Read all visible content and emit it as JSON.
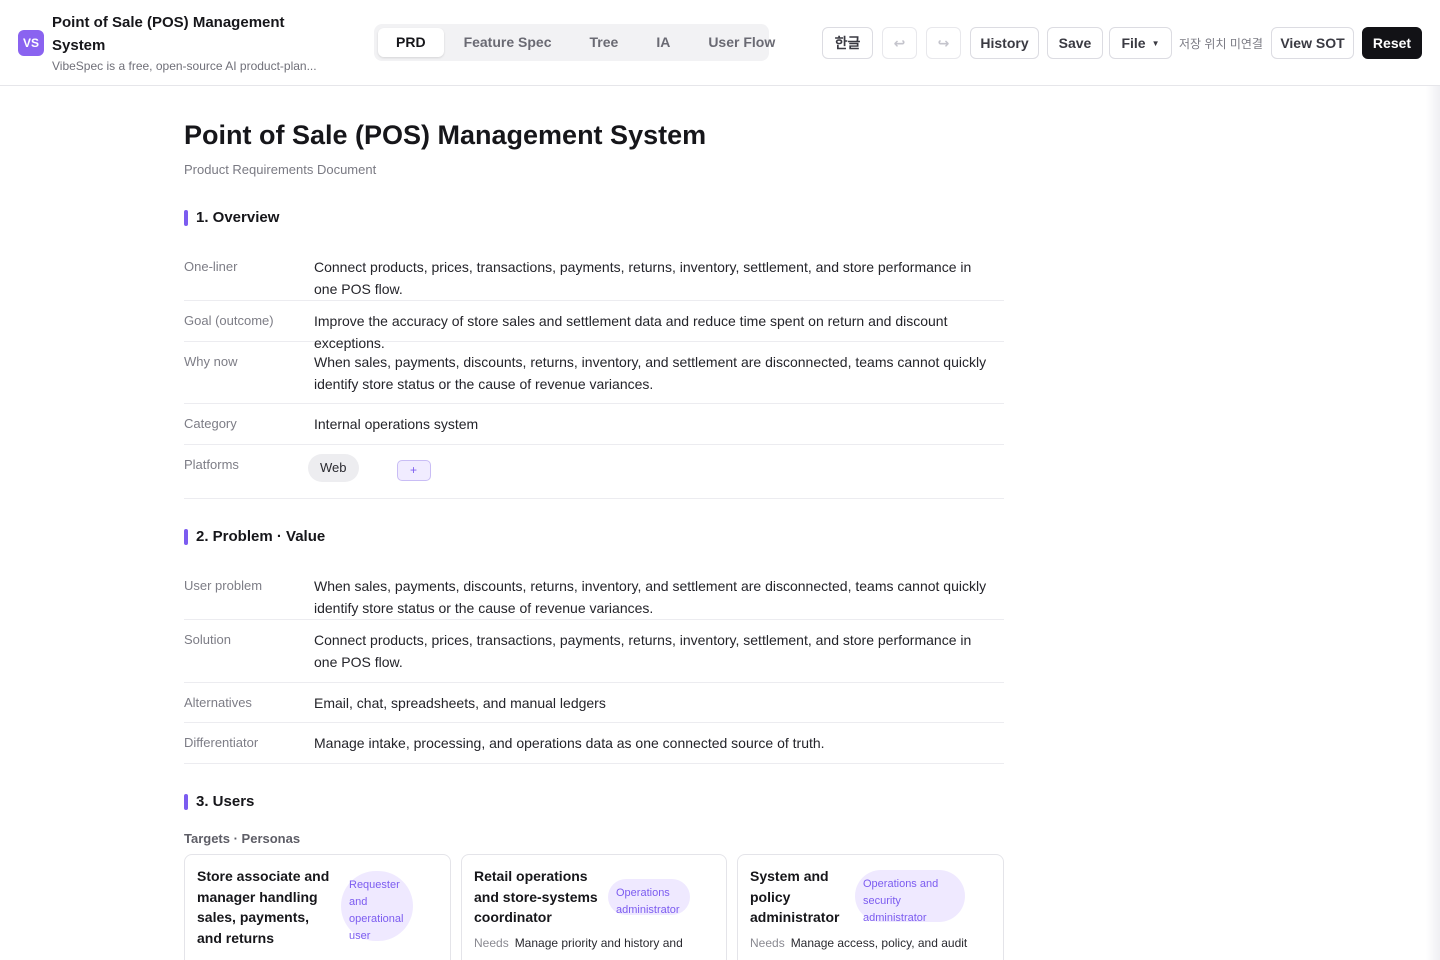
{
  "header": {
    "logo_text": "VS",
    "title": "Point of Sale (POS) Management System",
    "subtitle": "VibeSpec is a free, open-source AI product-plan...",
    "tabs": [
      {
        "label": "PRD",
        "active": true
      },
      {
        "label": "Feature Spec",
        "active": false
      },
      {
        "label": "Tree",
        "active": false
      },
      {
        "label": "IA",
        "active": false
      },
      {
        "label": "User Flow",
        "active": false
      }
    ],
    "language_label": "한글",
    "undo_icon": "↩",
    "redo_icon": "↪",
    "history_label": "History",
    "save_label": "Save",
    "file_label": "File",
    "save_location_status": "저장 위치 미연결",
    "view_sot_label": "View SOT",
    "reset_label": "Reset"
  },
  "document": {
    "title": "Point of Sale (POS) Management System",
    "subtitle": "Product Requirements Document",
    "overview": {
      "heading": "1. Overview",
      "rows": [
        {
          "label": "One-liner",
          "value": "Connect products, prices, transactions, payments, returns, inventory, settlement, and store performance in one POS flow."
        },
        {
          "label": "Goal (outcome)",
          "value": "Improve the accuracy of store sales and settlement data and reduce time spent on return and discount exceptions."
        },
        {
          "label": "Why now",
          "value": "When sales, payments, discounts, returns, inventory, and settlement are disconnected, teams cannot quickly identify store status or the cause of revenue variances."
        },
        {
          "label": "Category",
          "value": "Internal operations system"
        }
      ],
      "platforms_label": "Platforms",
      "platforms": [
        "Web"
      ],
      "add_platform_label": "+"
    },
    "problem": {
      "heading": "2. Problem · Value",
      "rows": [
        {
          "label": "User problem",
          "value": "When sales, payments, discounts, returns, inventory, and settlement are disconnected, teams cannot quickly identify store status or the cause of revenue variances."
        },
        {
          "label": "Solution",
          "value": "Connect products, prices, transactions, payments, returns, inventory, settlement, and store performance in one POS flow."
        },
        {
          "label": "Alternatives",
          "value": "Email, chat, spreadsheets, and manual ledgers"
        },
        {
          "label": "Differentiator",
          "value": "Manage intake, processing, and operations data as one connected source of truth."
        }
      ]
    },
    "users": {
      "heading": "3. Users",
      "targets_heading": "Targets · Personas",
      "needs_label": "Needs",
      "personas": [
        {
          "name": "Store associate and manager handling sales, payments, and returns",
          "role": "Requester and operational user",
          "needs": ""
        },
        {
          "name": "Retail operations and store-systems coordinator",
          "role": "Operations administrator",
          "needs": "Manage priority and history and"
        },
        {
          "name": "System and policy administrator",
          "role": "Operations and security administrator",
          "needs": "Manage access, policy, and audit"
        }
      ]
    }
  }
}
